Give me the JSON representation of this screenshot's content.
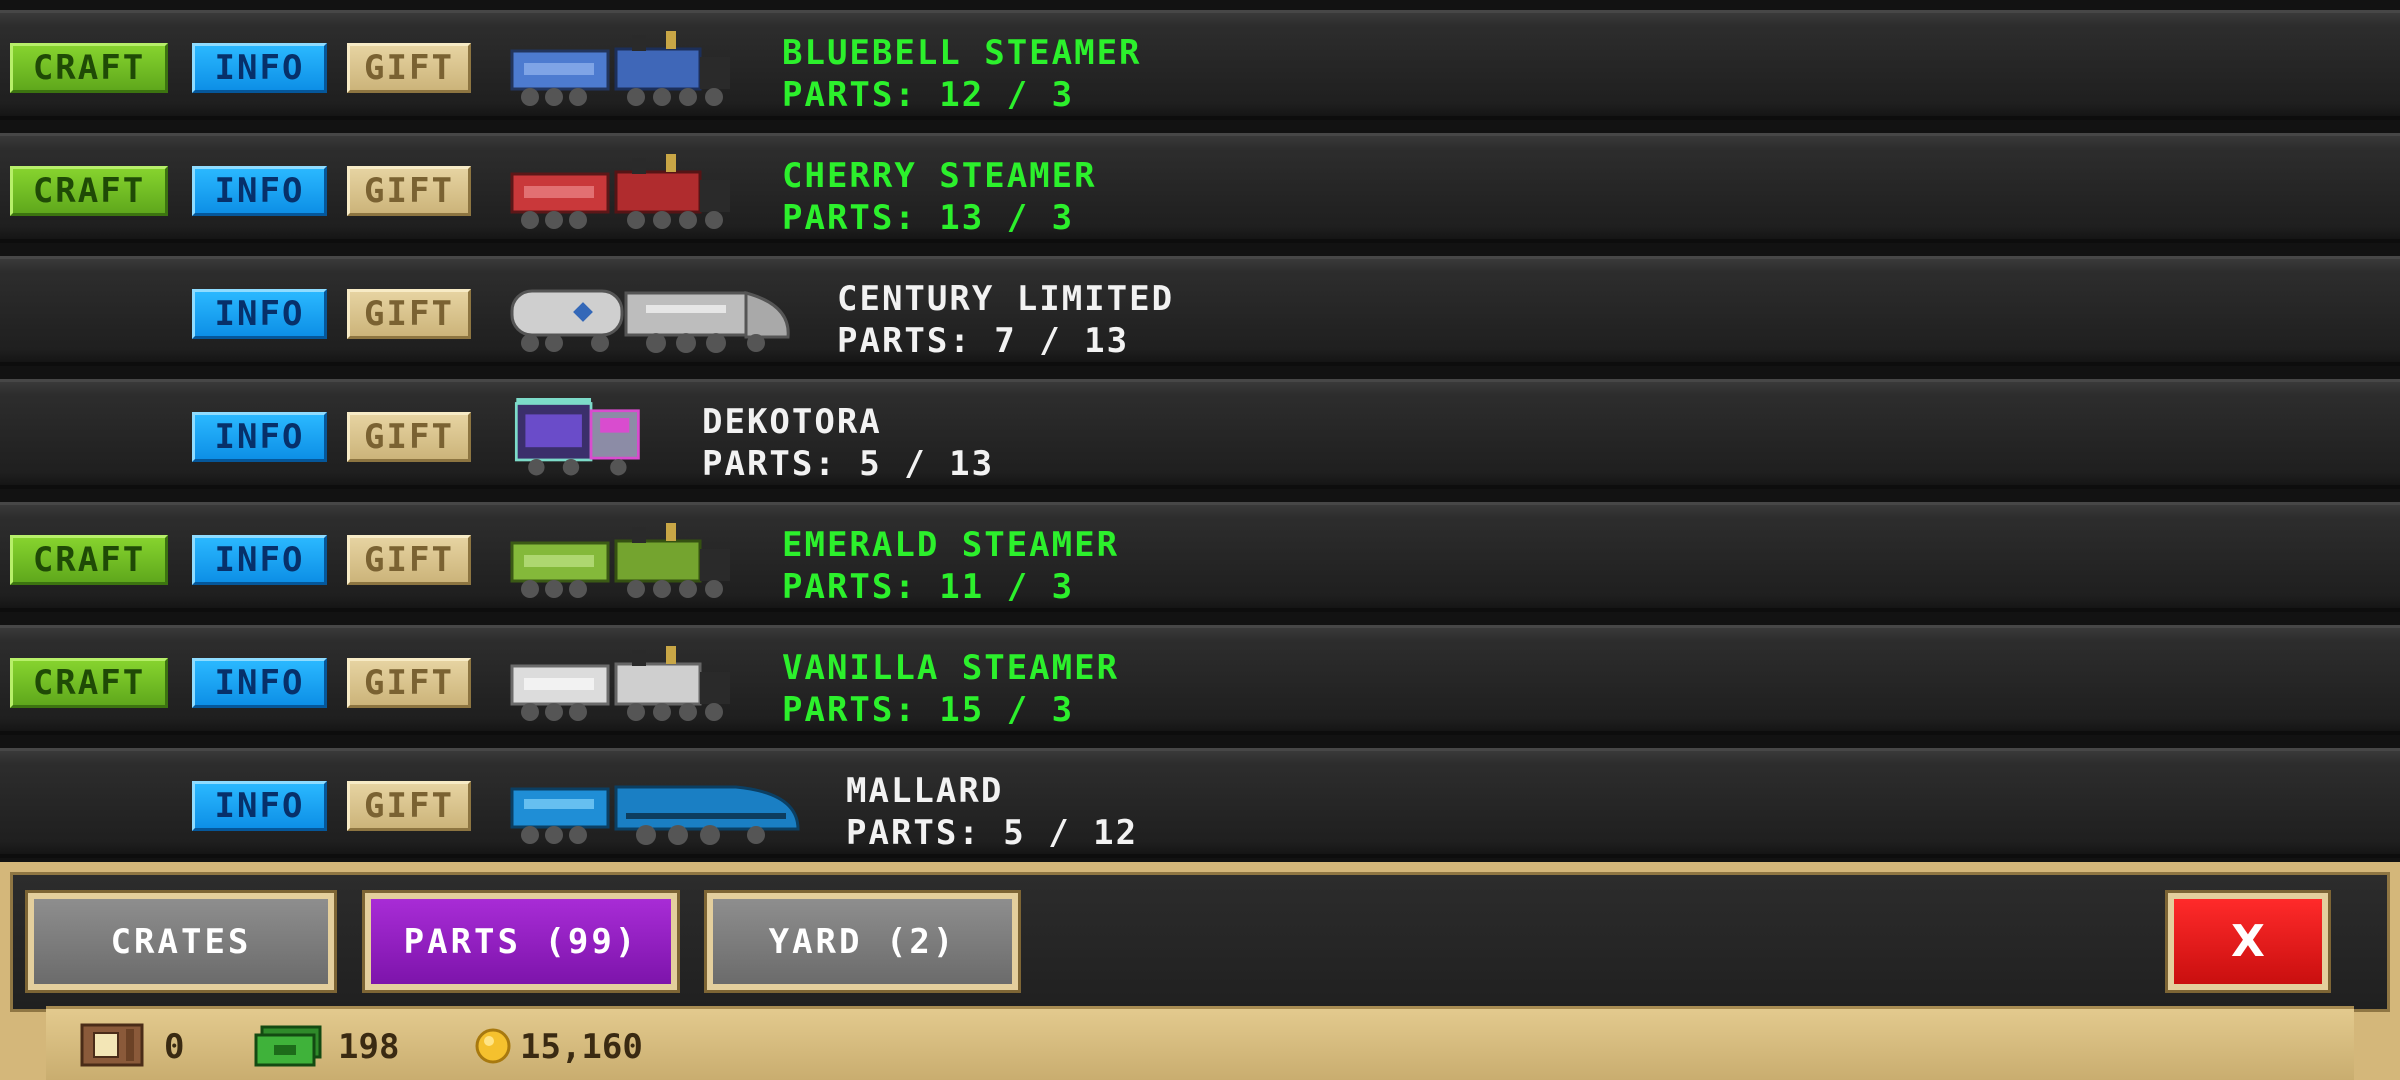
{
  "buttons": {
    "craft": "CRAFT",
    "info": "INFO",
    "gift": "GIFT"
  },
  "trains": [
    {
      "name": "BLUEBELL STEAMER",
      "parts": "PARTS: 12 / 3",
      "craftable": true,
      "color": "#4d7bd0"
    },
    {
      "name": "CHERRY STEAMER",
      "parts": "PARTS: 13 / 3",
      "craftable": true,
      "color": "#c9383a"
    },
    {
      "name": "CENTURY LIMITED",
      "parts": "PARTS: 7 / 13",
      "craftable": false,
      "color": "#b9b9b9"
    },
    {
      "name": "DEKOTORA",
      "parts": "PARTS: 5 / 13",
      "craftable": false,
      "color": "#7a4bd0"
    },
    {
      "name": "EMERALD STEAMER",
      "parts": "PARTS: 11 / 3",
      "craftable": true,
      "color": "#84b93a"
    },
    {
      "name": "VANILLA STEAMER",
      "parts": "PARTS: 15 / 3",
      "craftable": true,
      "color": "#d9d9d9"
    },
    {
      "name": "MALLARD",
      "parts": "PARTS: 5 / 12",
      "craftable": false,
      "color": "#1f8ed6"
    }
  ],
  "tabs": {
    "crates": "CRATES",
    "parts": "PARTS (99)",
    "yard": "YARD (2)",
    "close": "X"
  },
  "status": {
    "crates": "0",
    "cash": "198",
    "coins": "15,160"
  },
  "colors": {
    "craftable_text": "#2cf02c",
    "normal_text": "#f2f2f2",
    "active_tab": "#9b27c9",
    "close": "#e81515"
  }
}
